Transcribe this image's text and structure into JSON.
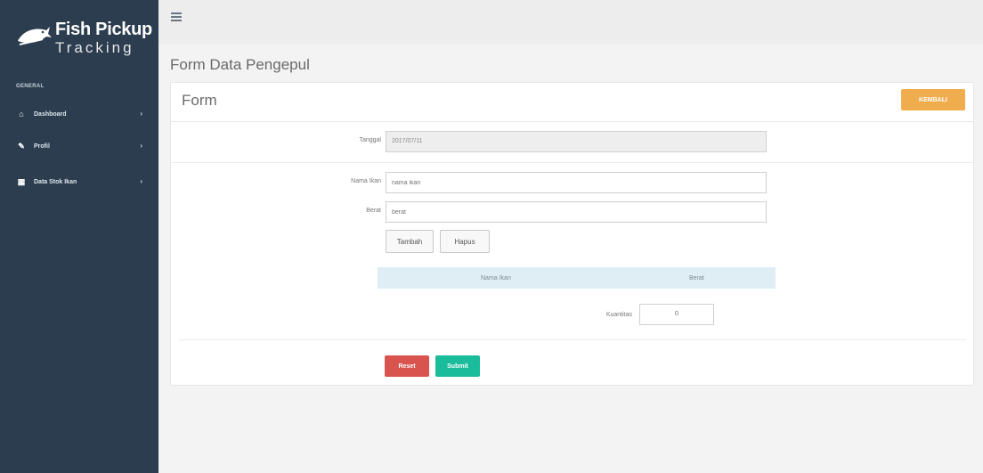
{
  "sidebar": {
    "brand_title": "Fish Pickup",
    "brand_subtitle": "Tracking",
    "heading": "GENERAL",
    "items": [
      {
        "label": "Dashboard",
        "icon": "home-icon"
      },
      {
        "label": "Profil",
        "icon": "edit-icon"
      },
      {
        "label": "Data Stok Ikan",
        "icon": "table-icon"
      }
    ]
  },
  "page": {
    "title": "Form Data Pengepul"
  },
  "form": {
    "panel_title": "Form",
    "back_label": "KEMBALI",
    "tanggal_label": "Tanggal",
    "tanggal_value": "2017/07/11",
    "nama_ikan_label": "Nama Ikan",
    "nama_ikan_placeholder": "nama ikan",
    "berat_label": "Berat",
    "berat_placeholder": "berat",
    "tambah_label": "Tambah",
    "hapus_label": "Hapus",
    "table_headers": [
      "Nama Ikan",
      "Berat"
    ],
    "kuantitas_label": "Kuantitas",
    "kuantitas_value": "0",
    "reset_label": "Reset",
    "submit_label": "Submit"
  },
  "colors": {
    "sidebar": "#2b3d4f",
    "warning": "#f0ad4e",
    "danger": "#d9534f",
    "success": "#1abc9c"
  }
}
